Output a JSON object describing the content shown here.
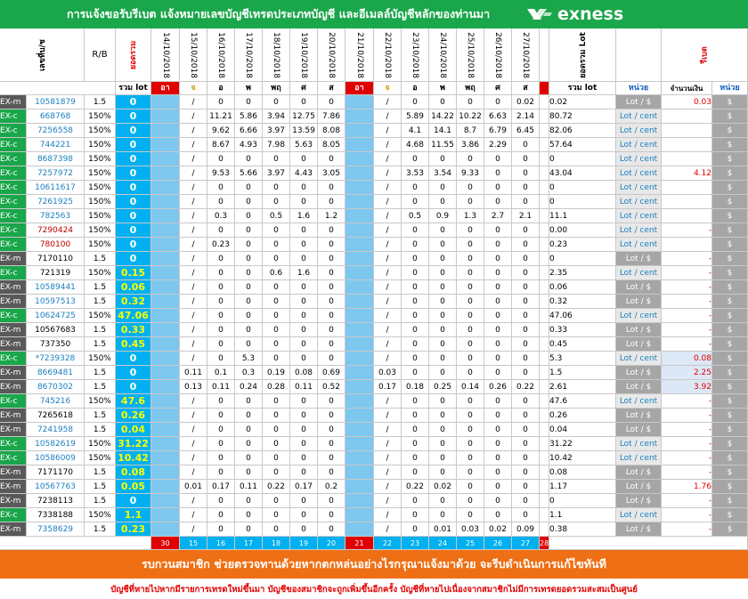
{
  "header": {
    "title": "การแจ้งขอรับรีเบต  แจ้งหมายเลขบัญชีเทรดประเภทบัญชี  และอีเมลล์บัญชีหลักของท่านมา",
    "logo_text": "exness"
  },
  "columns": {
    "account": "เลขที่บ/ช",
    "rb": "R/B",
    "net": "ยอดรวม",
    "dates": [
      "14/10/2018",
      "15/10/2018",
      "16/10/2018",
      "17/10/2018",
      "18/10/2018",
      "19/10/2018",
      "20/10/2018",
      "21/10/2018",
      "22/10/2018",
      "23/10/2018",
      "24/10/2018",
      "25/10/2018",
      "26/10/2018",
      "27/10/2018"
    ],
    "total": "ยอดรวม Lot",
    "rebate": "รีเบต"
  },
  "subheaders": {
    "total_lot": "รวม lot",
    "days": [
      "อา",
      "จ",
      "อ",
      "พ",
      "พฤ",
      "ศ",
      "ส",
      "อา",
      "จ",
      "อ",
      "พ",
      "พฤ",
      "ศ",
      "ส"
    ],
    "total_lot2": "รวม lot",
    "unit": "หน่วย",
    "amount": "จำนวนเงิน",
    "unit2": "หน่วย"
  },
  "rows": [
    {
      "type": "EX-m",
      "acct": "10581879",
      "rb": "1.5",
      "net": "0",
      "v": [
        "",
        "/",
        "0",
        "0",
        "0",
        "0",
        "0",
        "",
        "/",
        "0",
        "0",
        "0",
        "0",
        "0.02"
      ],
      "total": "0.02",
      "unit": "Lot / $",
      "amt": "0.03",
      "cur": "$"
    },
    {
      "type": "EX-c",
      "acct": "668768",
      "rb": "150%",
      "net": "0",
      "v": [
        "",
        "/",
        "11.21",
        "5.86",
        "3.94",
        "12.75",
        "7.86",
        "",
        "/",
        "5.89",
        "14.22",
        "10.22",
        "6.63",
        "2.14"
      ],
      "total": "80.72",
      "unit": "Lot / cent",
      "amt": "",
      "cur": "$"
    },
    {
      "type": "EX-c",
      "acct": "7256558",
      "rb": "150%",
      "net": "0",
      "v": [
        "",
        "/",
        "9.62",
        "6.66",
        "3.97",
        "13.59",
        "8.08",
        "",
        "/",
        "4.1",
        "14.1",
        "8.7",
        "6.79",
        "6.45"
      ],
      "total": "82.06",
      "unit": "Lot / cent",
      "amt": "",
      "cur": "$"
    },
    {
      "type": "EX-c",
      "acct": "744221",
      "rb": "150%",
      "net": "0",
      "v": [
        "",
        "/",
        "8.67",
        "4.93",
        "7.98",
        "5.63",
        "8.05",
        "",
        "/",
        "4.68",
        "11.55",
        "3.86",
        "2.29",
        "0"
      ],
      "total": "57.64",
      "unit": "Lot / cent",
      "amt": "",
      "cur": "$"
    },
    {
      "type": "EX-c",
      "acct": "8687398",
      "rb": "150%",
      "net": "0",
      "v": [
        "",
        "/",
        "0",
        "0",
        "0",
        "0",
        "0",
        "",
        "/",
        "0",
        "0",
        "0",
        "0",
        "0"
      ],
      "total": "0",
      "unit": "Lot / cent",
      "amt": "",
      "cur": "$"
    },
    {
      "type": "EX-c",
      "acct": "7257972",
      "rb": "150%",
      "net": "0",
      "v": [
        "",
        "/",
        "9.53",
        "5.66",
        "3.97",
        "4.43",
        "3.05",
        "",
        "/",
        "3.53",
        "3.54",
        "9.33",
        "0",
        "0"
      ],
      "total": "43.04",
      "unit": "Lot / cent",
      "amt": "4.12",
      "cur": "$"
    },
    {
      "type": "EX-c",
      "acct": "10611617",
      "rb": "150%",
      "net": "0",
      "v": [
        "",
        "/",
        "0",
        "0",
        "0",
        "0",
        "0",
        "",
        "/",
        "0",
        "0",
        "0",
        "0",
        "0"
      ],
      "total": "0",
      "unit": "Lot / cent",
      "amt": "",
      "cur": "$"
    },
    {
      "type": "EX-c",
      "acct": "7261925",
      "rb": "150%",
      "net": "0",
      "v": [
        "",
        "/",
        "0",
        "0",
        "0",
        "0",
        "0",
        "",
        "/",
        "0",
        "0",
        "0",
        "0",
        "0"
      ],
      "total": "0",
      "unit": "Lot / cent",
      "amt": "",
      "cur": "$"
    },
    {
      "type": "EX-c",
      "acct": "782563",
      "rb": "150%",
      "net": "0",
      "v": [
        "",
        "/",
        "0.3",
        "0",
        "0.5",
        "1.6",
        "1.2",
        "",
        "/",
        "0.5",
        "0.9",
        "1.3",
        "2.7",
        "2.1"
      ],
      "total": "11.1",
      "unit": "Lot / cent",
      "amt": "",
      "cur": "$"
    },
    {
      "type": "EX-c",
      "acct": "7290424",
      "rb": "150%",
      "net": "0",
      "v": [
        "",
        "/",
        "0",
        "0",
        "0",
        "0",
        "0",
        "",
        "/",
        "0",
        "0",
        "0",
        "0",
        "0"
      ],
      "total": "0.00",
      "unit": "Lot / cent",
      "amt": "-",
      "cur": "$"
    },
    {
      "type": "EX-c",
      "acct": "780100",
      "rb": "150%",
      "net": "0",
      "v": [
        "",
        "/",
        "0.23",
        "0",
        "0",
        "0",
        "0",
        "",
        "/",
        "0",
        "0",
        "0",
        "0",
        "0"
      ],
      "total": "0.23",
      "unit": "Lot / cent",
      "amt": "",
      "cur": "$"
    },
    {
      "type": "EX-m",
      "acct": "7170110",
      "rb": "1.5",
      "net": "0",
      "v": [
        "",
        "/",
        "0",
        "0",
        "0",
        "0",
        "0",
        "",
        "/",
        "0",
        "0",
        "0",
        "0",
        "0"
      ],
      "total": "0",
      "unit": "Lot / $",
      "amt": "-",
      "cur": "$"
    },
    {
      "type": "EX-c",
      "acct": "721319",
      "rb": "150%",
      "net": "0.15",
      "v": [
        "",
        "/",
        "0",
        "0",
        "0.6",
        "1.6",
        "0",
        "",
        "/",
        "0",
        "0",
        "0",
        "0",
        "0"
      ],
      "total": "2.35",
      "unit": "Lot / cent",
      "amt": "-",
      "cur": "$"
    },
    {
      "type": "EX-m",
      "acct": "10589441",
      "rb": "1.5",
      "net": "0.06",
      "v": [
        "",
        "/",
        "0",
        "0",
        "0",
        "0",
        "0",
        "",
        "/",
        "0",
        "0",
        "0",
        "0",
        "0"
      ],
      "total": "0.06",
      "unit": "Lot / $",
      "amt": "-",
      "cur": "$"
    },
    {
      "type": "EX-m",
      "acct": "10597513",
      "rb": "1.5",
      "net": "0.32",
      "v": [
        "",
        "/",
        "0",
        "0",
        "0",
        "0",
        "0",
        "",
        "/",
        "0",
        "0",
        "0",
        "0",
        "0"
      ],
      "total": "0.32",
      "unit": "Lot / $",
      "amt": "-",
      "cur": "$"
    },
    {
      "type": "EX-c",
      "acct": "10624725",
      "rb": "150%",
      "net": "47.06",
      "v": [
        "",
        "/",
        "0",
        "0",
        "0",
        "0",
        "0",
        "",
        "/",
        "0",
        "0",
        "0",
        "0",
        "0"
      ],
      "total": "47.06",
      "unit": "Lot / cent",
      "amt": "-",
      "cur": "$"
    },
    {
      "type": "EX-m",
      "acct": "10567683",
      "rb": "1.5",
      "net": "0.33",
      "v": [
        "",
        "/",
        "0",
        "0",
        "0",
        "0",
        "0",
        "",
        "/",
        "0",
        "0",
        "0",
        "0",
        "0"
      ],
      "total": "0.33",
      "unit": "Lot / $",
      "amt": "-",
      "cur": "$"
    },
    {
      "type": "EX-m",
      "acct": "737350",
      "rb": "1.5",
      "net": "0.45",
      "v": [
        "",
        "/",
        "0",
        "0",
        "0",
        "0",
        "0",
        "",
        "/",
        "0",
        "0",
        "0",
        "0",
        "0"
      ],
      "total": "0.45",
      "unit": "Lot / $",
      "amt": "-",
      "cur": "$"
    },
    {
      "type": "EX-c",
      "acct": "*7239328",
      "rb": "150%",
      "net": "0",
      "v": [
        "",
        "/",
        "0",
        "5.3",
        "0",
        "0",
        "0",
        "",
        "/",
        "0",
        "0",
        "0",
        "0",
        "0"
      ],
      "total": "5.3",
      "unit": "Lot / cent",
      "amt": "0.08",
      "cur": "$"
    },
    {
      "type": "EX-m",
      "acct": "8669481",
      "rb": "1.5",
      "net": "0",
      "v": [
        "",
        "0.11",
        "0.1",
        "0.3",
        "0.19",
        "0.08",
        "0.69",
        "",
        "0.03",
        "0",
        "0",
        "0",
        "0",
        "0"
      ],
      "total": "1.5",
      "unit": "Lot / $",
      "amt": "2.25",
      "cur": "$"
    },
    {
      "type": "EX-m",
      "acct": "8670302",
      "rb": "1.5",
      "net": "0",
      "v": [
        "",
        "0.13",
        "0.11",
        "0.24",
        "0.28",
        "0.11",
        "0.52",
        "",
        "0.17",
        "0.18",
        "0.25",
        "0.14",
        "0.26",
        "0.22"
      ],
      "total": "2.61",
      "unit": "Lot / $",
      "amt": "3.92",
      "cur": "$"
    },
    {
      "type": "EX-c",
      "acct": "745216",
      "rb": "150%",
      "net": "47.6",
      "v": [
        "",
        "/",
        "0",
        "0",
        "0",
        "0",
        "0",
        "",
        "/",
        "0",
        "0",
        "0",
        "0",
        "0"
      ],
      "total": "47.6",
      "unit": "Lot / cent",
      "amt": "-",
      "cur": "$"
    },
    {
      "type": "EX-m",
      "acct": "7265618",
      "rb": "1.5",
      "net": "0.26",
      "v": [
        "",
        "/",
        "0",
        "0",
        "0",
        "0",
        "0",
        "",
        "/",
        "0",
        "0",
        "0",
        "0",
        "0"
      ],
      "total": "0.26",
      "unit": "Lot / $",
      "amt": "-",
      "cur": "$"
    },
    {
      "type": "EX-m",
      "acct": "7241958",
      "rb": "1.5",
      "net": "0.04",
      "v": [
        "",
        "/",
        "0",
        "0",
        "0",
        "0",
        "0",
        "",
        "/",
        "0",
        "0",
        "0",
        "0",
        "0"
      ],
      "total": "0.04",
      "unit": "Lot / $",
      "amt": "-",
      "cur": "$"
    },
    {
      "type": "EX-c",
      "acct": "10582619",
      "rb": "150%",
      "net": "31.22",
      "v": [
        "",
        "/",
        "0",
        "0",
        "0",
        "0",
        "0",
        "",
        "/",
        "0",
        "0",
        "0",
        "0",
        "0"
      ],
      "total": "31.22",
      "unit": "Lot / cent",
      "amt": "-",
      "cur": "$"
    },
    {
      "type": "EX-c",
      "acct": "10586009",
      "rb": "150%",
      "net": "10.42",
      "v": [
        "",
        "/",
        "0",
        "0",
        "0",
        "0",
        "0",
        "",
        "/",
        "0",
        "0",
        "0",
        "0",
        "0"
      ],
      "total": "10.42",
      "unit": "Lot / cent",
      "amt": "-",
      "cur": "$"
    },
    {
      "type": "EX-m",
      "acct": "7171170",
      "rb": "1.5",
      "net": "0.08",
      "v": [
        "",
        "/",
        "0",
        "0",
        "0",
        "0",
        "0",
        "",
        "/",
        "0",
        "0",
        "0",
        "0",
        "0"
      ],
      "total": "0.08",
      "unit": "Lot / $",
      "amt": "-",
      "cur": "$"
    },
    {
      "type": "EX-m",
      "acct": "10567763",
      "rb": "1.5",
      "net": "0.05",
      "v": [
        "",
        "0.01",
        "0.17",
        "0.11",
        "0.22",
        "0.17",
        "0.2",
        "",
        "/",
        "0.22",
        "0.02",
        "0",
        "0",
        "0"
      ],
      "total": "1.17",
      "unit": "Lot / $",
      "amt": "1.76",
      "cur": "$"
    },
    {
      "type": "EX-m",
      "acct": "7238113",
      "rb": "1.5",
      "net": "0",
      "v": [
        "",
        "/",
        "0",
        "0",
        "0",
        "0",
        "0",
        "",
        "/",
        "0",
        "0",
        "0",
        "0",
        "0"
      ],
      "total": "0",
      "unit": "Lot / $",
      "amt": "-",
      "cur": "$"
    },
    {
      "type": "EX-c",
      "acct": "7338188",
      "rb": "150%",
      "net": "1.1",
      "v": [
        "",
        "/",
        "0",
        "0",
        "0",
        "0",
        "0",
        "",
        "/",
        "0",
        "0",
        "0",
        "0",
        "0"
      ],
      "total": "1.1",
      "unit": "Lot / cent",
      "amt": "-",
      "cur": "$"
    },
    {
      "type": "EX-m",
      "acct": "7358629",
      "rb": "1.5",
      "net": "0.23",
      "v": [
        "",
        "/",
        "0",
        "0",
        "0",
        "0",
        "0",
        "",
        "/",
        "0",
        "0.01",
        "0.03",
        "0.02",
        "0.09"
      ],
      "total": "0.38",
      "unit": "Lot / $",
      "amt": "-",
      "cur": "$"
    }
  ],
  "day_numbers": [
    "30",
    "15",
    "16",
    "17",
    "18",
    "19",
    "20",
    "21",
    "22",
    "23",
    "24",
    "25",
    "26",
    "27",
    "28"
  ],
  "footer": {
    "message": "รบกวนสมาชิก ช่วยตรวจทานด้วยหากตกหล่นอย่างไรกรุณาแจ้งมาด้วย  จะรีบดำเนินการแก้ไขทันที",
    "note": "บัญชีที่หายไปหากมีรายการเทรดใหม่ขึ้นมา บัญชีของสมาชิกจะถูกเพิ่มขึ้นอีกครั้ง บัญชีที่หายไปเนื่องจากสมาชิกไม่มีการเทรดยอดรวมสะสมเป็นศูนย์"
  },
  "colors": {
    "header_green": "#1aa64a",
    "orange": "#ee6f14",
    "cyan": "#00b0f0",
    "gray": "#a6a6a6",
    "red": "#e00000"
  }
}
